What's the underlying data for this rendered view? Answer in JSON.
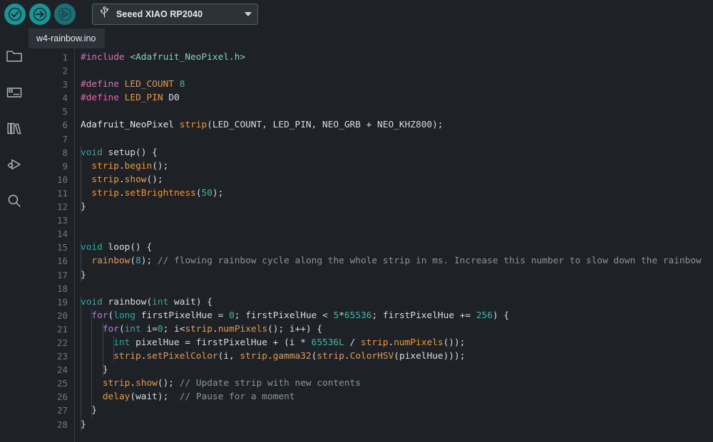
{
  "toolbar": {
    "verify_label": "Verify",
    "upload_label": "Upload",
    "debug_label": "Debug",
    "board": {
      "name": "Seeed XIAO RP2040",
      "icon": "usb-icon",
      "caret": "chevron-down-icon"
    }
  },
  "sidebar": {
    "items": [
      {
        "name": "sketchbook",
        "icon": "folder-icon"
      },
      {
        "name": "boards-manager",
        "icon": "boards-manager-icon"
      },
      {
        "name": "library-manager",
        "icon": "books-icon"
      },
      {
        "name": "debug",
        "icon": "debug-icon"
      },
      {
        "name": "search",
        "icon": "search-icon"
      }
    ]
  },
  "tabs": [
    {
      "label": "w4-rainbow.ino",
      "active": true
    }
  ],
  "editor": {
    "filename": "w4-rainbow.ino",
    "language": "arduino",
    "first_line": 1,
    "last_line": 28,
    "line_numbers": [
      1,
      2,
      3,
      4,
      5,
      6,
      7,
      8,
      9,
      10,
      11,
      12,
      13,
      14,
      15,
      16,
      17,
      18,
      19,
      20,
      21,
      22,
      23,
      24,
      25,
      26,
      27,
      28
    ],
    "colors": {
      "background": "#1e2227",
      "foreground": "#d6dde0",
      "line_number": "#6b7a82",
      "preprocessor": "#e668b5",
      "include_path": "#7fd3c8",
      "keyword": "#2ea9a0",
      "control": "#b37fd8",
      "function": "#e8993f",
      "number": "#3fb6a8",
      "comment": "#8a949a",
      "accent": "#1b9494",
      "tab_active_bg": "#2b3238"
    },
    "lines": [
      {
        "n": 1,
        "text": "#include <Adafruit_NeoPixel.h>"
      },
      {
        "n": 2,
        "text": ""
      },
      {
        "n": 3,
        "text": "#define LED_COUNT 8"
      },
      {
        "n": 4,
        "text": "#define LED_PIN D0"
      },
      {
        "n": 5,
        "text": ""
      },
      {
        "n": 6,
        "text": "Adafruit_NeoPixel strip(LED_COUNT, LED_PIN, NEO_GRB + NEO_KHZ800);"
      },
      {
        "n": 7,
        "text": ""
      },
      {
        "n": 8,
        "text": "void setup() {"
      },
      {
        "n": 9,
        "text": "  strip.begin();"
      },
      {
        "n": 10,
        "text": "  strip.show();"
      },
      {
        "n": 11,
        "text": "  strip.setBrightness(50);"
      },
      {
        "n": 12,
        "text": "}"
      },
      {
        "n": 13,
        "text": ""
      },
      {
        "n": 14,
        "text": ""
      },
      {
        "n": 15,
        "text": "void loop() {"
      },
      {
        "n": 16,
        "text": "  rainbow(8); // flowing rainbow cycle along the whole strip in ms. Increase this number to slow down the rainbow"
      },
      {
        "n": 17,
        "text": "}"
      },
      {
        "n": 18,
        "text": ""
      },
      {
        "n": 19,
        "text": "void rainbow(int wait) {"
      },
      {
        "n": 20,
        "text": "  for(long firstPixelHue = 0; firstPixelHue < 5*65536; firstPixelHue += 256) {"
      },
      {
        "n": 21,
        "text": "    for(int i=0; i<strip.numPixels(); i++) {"
      },
      {
        "n": 22,
        "text": "      int pixelHue = firstPixelHue + (i * 65536L / strip.numPixels());"
      },
      {
        "n": 23,
        "text": "      strip.setPixelColor(i, strip.gamma32(strip.ColorHSV(pixelHue)));"
      },
      {
        "n": 24,
        "text": "    }"
      },
      {
        "n": 25,
        "text": "    strip.show(); // Update strip with new contents"
      },
      {
        "n": 26,
        "text": "    delay(wait);  // Pause for a moment"
      },
      {
        "n": 27,
        "text": "  }"
      },
      {
        "n": 28,
        "text": "}"
      }
    ],
    "tokens": [
      [
        {
          "t": "#include",
          "c": "t-pre"
        },
        {
          "t": " ",
          "c": "t-punc"
        },
        {
          "t": "<Adafruit_NeoPixel.h>",
          "c": "t-inc"
        }
      ],
      [],
      [
        {
          "t": "#define",
          "c": "t-pre"
        },
        {
          "t": " ",
          "c": "t-punc"
        },
        {
          "t": "LED_COUNT",
          "c": "t-fn"
        },
        {
          "t": " ",
          "c": "t-punc"
        },
        {
          "t": "8",
          "c": "t-num"
        }
      ],
      [
        {
          "t": "#define",
          "c": "t-pre"
        },
        {
          "t": " ",
          "c": "t-punc"
        },
        {
          "t": "LED_PIN",
          "c": "t-fn"
        },
        {
          "t": " ",
          "c": "t-punc"
        },
        {
          "t": "D0",
          "c": "t-const"
        }
      ],
      [],
      [
        {
          "t": "Adafruit_NeoPixel ",
          "c": "t-ident"
        },
        {
          "t": "strip",
          "c": "t-fn"
        },
        {
          "t": "(LED_COUNT, LED_PIN, NEO_GRB + NEO_KHZ800);",
          "c": "t-punc"
        }
      ],
      [],
      [
        {
          "t": "void",
          "c": "t-kw"
        },
        {
          "t": " setup() {",
          "c": "t-punc"
        }
      ],
      [
        {
          "t": "  strip",
          "c": "t-fn"
        },
        {
          "t": ".",
          "c": "t-punc"
        },
        {
          "t": "begin",
          "c": "t-fn"
        },
        {
          "t": "();",
          "c": "t-punc"
        }
      ],
      [
        {
          "t": "  strip",
          "c": "t-fn"
        },
        {
          "t": ".",
          "c": "t-punc"
        },
        {
          "t": "show",
          "c": "t-fn"
        },
        {
          "t": "();",
          "c": "t-punc"
        }
      ],
      [
        {
          "t": "  strip",
          "c": "t-fn"
        },
        {
          "t": ".",
          "c": "t-punc"
        },
        {
          "t": "setBrightness",
          "c": "t-fn"
        },
        {
          "t": "(",
          "c": "t-punc"
        },
        {
          "t": "50",
          "c": "t-num"
        },
        {
          "t": ");",
          "c": "t-punc"
        }
      ],
      [
        {
          "t": "}",
          "c": "t-punc"
        }
      ],
      [],
      [],
      [
        {
          "t": "void",
          "c": "t-kw"
        },
        {
          "t": " loop() {",
          "c": "t-punc"
        }
      ],
      [
        {
          "t": "  ",
          "c": "t-punc"
        },
        {
          "t": "rainbow",
          "c": "t-fn"
        },
        {
          "t": "(",
          "c": "t-punc"
        },
        {
          "t": "8",
          "c": "t-num"
        },
        {
          "t": "); ",
          "c": "t-punc"
        },
        {
          "t": "// flowing rainbow cycle along the whole strip in ms. Increase this number to slow down the rainbow",
          "c": "t-cmt"
        }
      ],
      [
        {
          "t": "}",
          "c": "t-punc"
        }
      ],
      [],
      [
        {
          "t": "void",
          "c": "t-kw"
        },
        {
          "t": " rainbow(",
          "c": "t-punc"
        },
        {
          "t": "int",
          "c": "t-kw"
        },
        {
          "t": " wait) {",
          "c": "t-punc"
        }
      ],
      [
        {
          "t": "  ",
          "c": "t-punc"
        },
        {
          "t": "for",
          "c": "t-ctrl"
        },
        {
          "t": "(",
          "c": "t-punc"
        },
        {
          "t": "long",
          "c": "t-kw"
        },
        {
          "t": " firstPixelHue = ",
          "c": "t-punc"
        },
        {
          "t": "0",
          "c": "t-num"
        },
        {
          "t": "; firstPixelHue < ",
          "c": "t-punc"
        },
        {
          "t": "5",
          "c": "t-num"
        },
        {
          "t": "*",
          "c": "t-punc"
        },
        {
          "t": "65536",
          "c": "t-num"
        },
        {
          "t": "; firstPixelHue += ",
          "c": "t-punc"
        },
        {
          "t": "256",
          "c": "t-num"
        },
        {
          "t": ") {",
          "c": "t-punc"
        }
      ],
      [
        {
          "t": "    ",
          "c": "t-punc"
        },
        {
          "t": "for",
          "c": "t-ctrl"
        },
        {
          "t": "(",
          "c": "t-punc"
        },
        {
          "t": "int",
          "c": "t-kw"
        },
        {
          "t": " i=",
          "c": "t-punc"
        },
        {
          "t": "0",
          "c": "t-num"
        },
        {
          "t": "; i<",
          "c": "t-punc"
        },
        {
          "t": "strip",
          "c": "t-fn"
        },
        {
          "t": ".",
          "c": "t-punc"
        },
        {
          "t": "numPixels",
          "c": "t-fn"
        },
        {
          "t": "(); i++) {",
          "c": "t-punc"
        }
      ],
      [
        {
          "t": "      ",
          "c": "t-punc"
        },
        {
          "t": "int",
          "c": "t-kw"
        },
        {
          "t": " pixelHue = firstPixelHue + (i * ",
          "c": "t-punc"
        },
        {
          "t": "65536L",
          "c": "t-num"
        },
        {
          "t": " / ",
          "c": "t-punc"
        },
        {
          "t": "strip",
          "c": "t-fn"
        },
        {
          "t": ".",
          "c": "t-punc"
        },
        {
          "t": "numPixels",
          "c": "t-fn"
        },
        {
          "t": "());",
          "c": "t-punc"
        }
      ],
      [
        {
          "t": "      strip",
          "c": "t-fn"
        },
        {
          "t": ".",
          "c": "t-punc"
        },
        {
          "t": "setPixelColor",
          "c": "t-fn"
        },
        {
          "t": "(i, ",
          "c": "t-punc"
        },
        {
          "t": "strip",
          "c": "t-fn"
        },
        {
          "t": ".",
          "c": "t-punc"
        },
        {
          "t": "gamma32",
          "c": "t-fn"
        },
        {
          "t": "(",
          "c": "t-punc"
        },
        {
          "t": "strip",
          "c": "t-fn"
        },
        {
          "t": ".",
          "c": "t-punc"
        },
        {
          "t": "ColorHSV",
          "c": "t-fn"
        },
        {
          "t": "(pixelHue)));",
          "c": "t-punc"
        }
      ],
      [
        {
          "t": "    }",
          "c": "t-punc"
        }
      ],
      [
        {
          "t": "    strip",
          "c": "t-fn"
        },
        {
          "t": ".",
          "c": "t-punc"
        },
        {
          "t": "show",
          "c": "t-fn"
        },
        {
          "t": "(); ",
          "c": "t-punc"
        },
        {
          "t": "// Update strip with new contents",
          "c": "t-cmt"
        }
      ],
      [
        {
          "t": "    ",
          "c": "t-punc"
        },
        {
          "t": "delay",
          "c": "t-fn"
        },
        {
          "t": "(wait);  ",
          "c": "t-punc"
        },
        {
          "t": "// Pause for a moment",
          "c": "t-cmt"
        }
      ],
      [
        {
          "t": "  }",
          "c": "t-punc"
        }
      ],
      [
        {
          "t": "}",
          "c": "t-punc"
        }
      ]
    ],
    "indent_guides": [
      {
        "col": 0,
        "from_line": 8,
        "to_line": 12
      },
      {
        "col": 0,
        "from_line": 15,
        "to_line": 17
      },
      {
        "col": 0,
        "from_line": 19,
        "to_line": 28
      },
      {
        "col": 2,
        "from_line": 20,
        "to_line": 27
      },
      {
        "col": 4,
        "from_line": 21,
        "to_line": 24
      },
      {
        "col": 6,
        "from_line": 22,
        "to_line": 23
      }
    ]
  }
}
